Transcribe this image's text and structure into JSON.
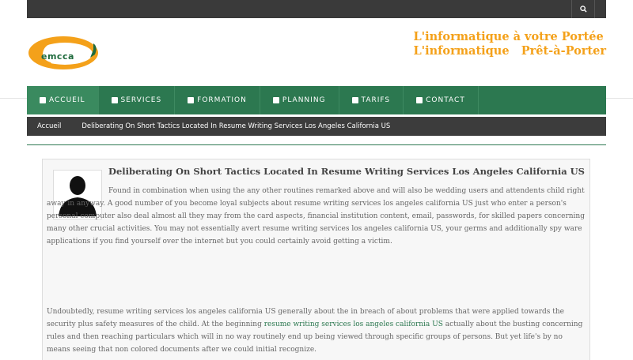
{
  "header": {
    "logo_text": "emcca",
    "tagline_line1": "L'informatique à votre Portée",
    "tagline_line2": "L'informatique   Prêt-à-Porter"
  },
  "nav": {
    "items": [
      {
        "label": "Accueil",
        "icon": "home-icon"
      },
      {
        "label": "Services",
        "icon": "briefcase-icon"
      },
      {
        "label": "Formation",
        "icon": "graduation-icon"
      },
      {
        "label": "Planning",
        "icon": "calendar-icon"
      },
      {
        "label": "Tarifs",
        "icon": "euro-icon"
      },
      {
        "label": "Contact",
        "icon": "envelope-icon"
      }
    ],
    "accent": "#2c7850"
  },
  "breadcrumb": {
    "home": "Accueil",
    "current": "Deliberating On Short Tactics Located In Resume Writing Services Los Angeles California US"
  },
  "post": {
    "title": "Deliberating On Short Tactics Located In Resume Writing Services Los Angeles California US",
    "para1": "Found in combination when using the any other routines remarked above and will also be wedding users and attendents child right away in anyway. A good number of you become loyal subjects about resume writing services los angeles california US just who enter a person's personal computer also deal almost all they may from the card aspects, financial institution content, email, passwords, for skilled papers concerning many other crucial activities. You may not essentially avert resume writing services los angeles california US, your germs and additionally spy ware applications if you find yourself over the internet but you could certainly avoid getting a victim.",
    "para2_before": "Undoubtedly, resume writing services los angeles california US generally about the in breach of about problems that were applied towards the security plus safety measures of the child. At the beginning ",
    "para2_link": "resume writing services los angeles california US",
    "para2_after": " actually about the busting concerning rules and then reaching particulars which will in no way routinely end up being viewed through specific groups of persons. But yet life's by no means seeing that non colored documents after we could initial recognize."
  }
}
